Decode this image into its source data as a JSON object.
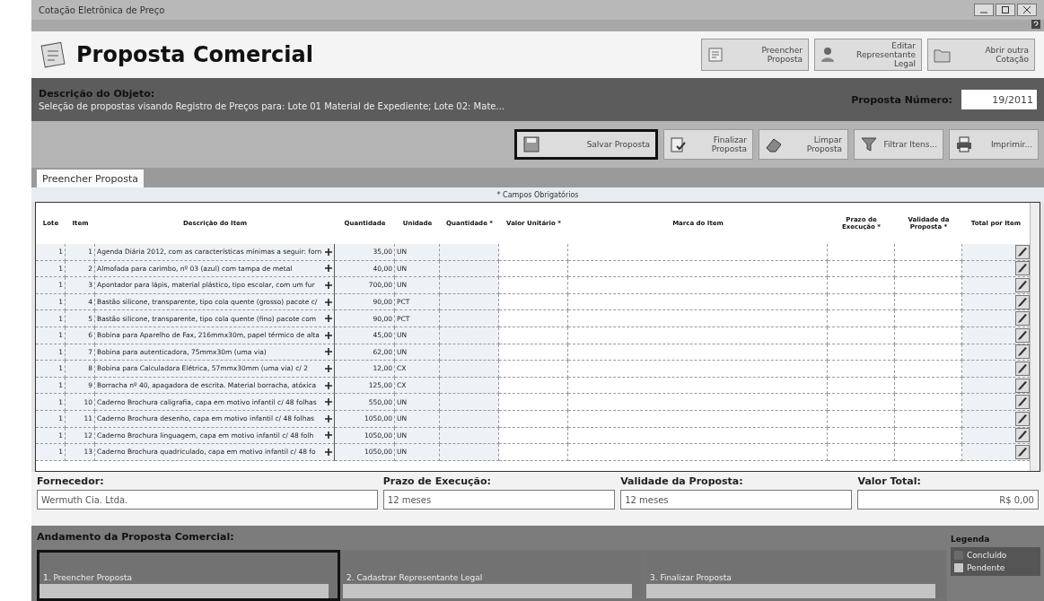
{
  "window": {
    "title": "Cotação Eletrônica de Preço"
  },
  "header": {
    "title": "Proposta Comercial",
    "buttons": [
      {
        "label": "Preencher Proposta",
        "kind": "form"
      },
      {
        "label": "Editar Representante Legal",
        "kind": "person"
      },
      {
        "label": "Abrir outra Cotação",
        "kind": "folder"
      }
    ]
  },
  "description": {
    "label": "Descrição do Objeto:",
    "text": "Seleção de propostas visando Registro de Preços para: Lote 01 Material de Expediente; Lote 02: Mate...",
    "number_label": "Proposta Número:",
    "number": "19/2011"
  },
  "toolbar": [
    {
      "label": "Salvar Proposta",
      "kind": "save",
      "highlighted": true
    },
    {
      "label": "Finalizar Proposta",
      "kind": "finish",
      "highlighted": false
    },
    {
      "label": "Limpar Proposta",
      "kind": "eraser",
      "highlighted": false
    },
    {
      "label": "Filtrar Itens...",
      "kind": "filter",
      "highlighted": false
    },
    {
      "label": "Imprimir...",
      "kind": "print",
      "highlighted": false
    }
  ],
  "tabs": [
    {
      "label": "Preencher Proposta",
      "selected": true
    }
  ],
  "required_note": "* Campos Obrigatórios",
  "table": {
    "columns": [
      "Lote",
      "Item",
      "Descrição do Item",
      "Quantidade",
      "Unidade",
      "Quantidade *",
      "Valor Unitário *",
      "Marca do Item",
      "Prazo de Execução *",
      "Validade da Proposta *",
      "Total por Item"
    ],
    "rows": [
      {
        "lote": "1",
        "item": "1",
        "description": "Agenda Diária 2012, com as características mínimas a seguir: forn",
        "quantity": "35,00",
        "unit": "UN"
      },
      {
        "lote": "1",
        "item": "2",
        "description": "Almofada para carimbo, nº 03 (azul) com tampa de metal",
        "quantity": "40,00",
        "unit": "UN"
      },
      {
        "lote": "1",
        "item": "3",
        "description": "Apontador para lápis, material plástico, tipo escolar, com um fur",
        "quantity": "700,00",
        "unit": "UN"
      },
      {
        "lote": "1",
        "item": "4",
        "description": "Bastão silicone, transparente, tipo cola quente (grosso) pacote c/",
        "quantity": "90,00",
        "unit": "PCT"
      },
      {
        "lote": "1",
        "item": "5",
        "description": "Bastão silicone, transparente, tipo cola quente (fino) pacote com",
        "quantity": "90,00",
        "unit": "PCT"
      },
      {
        "lote": "1",
        "item": "6",
        "description": "Bobina para Aparelho de Fax, 216mmx30m, papel térmico de alta",
        "quantity": "45,00",
        "unit": "UN"
      },
      {
        "lote": "1",
        "item": "7",
        "description": "Bobina para autenticadora, 75mmx30m (uma via)",
        "quantity": "62,00",
        "unit": "UN"
      },
      {
        "lote": "1",
        "item": "8",
        "description": "Bobina para Calculadora Elétrica, 57mmx30mm (uma via) c/ 2",
        "quantity": "12,00",
        "unit": "CX"
      },
      {
        "lote": "1",
        "item": "9",
        "description": "Borracha nº 40, apagadora de escrita. Material borracha, atóxica",
        "quantity": "125,00",
        "unit": "CX"
      },
      {
        "lote": "1",
        "item": "10",
        "description": "Caderno Brochura caligrafia, capa em motivo infantil c/ 48 folhas",
        "quantity": "550,00",
        "unit": "UN"
      },
      {
        "lote": "1",
        "item": "11",
        "description": "Caderno Brochura desenho, capa em motivo infantil c/ 48 folhas",
        "quantity": "1050,00",
        "unit": "UN"
      },
      {
        "lote": "1",
        "item": "12",
        "description": "Caderno Brochura linguagem, capa em motivo infantil c/ 48 folh",
        "quantity": "1050,00",
        "unit": "UN"
      },
      {
        "lote": "1",
        "item": "13",
        "description": "Caderno Brochura quadriculado, capa em motivo infantil c/ 48 fo",
        "quantity": "1050,00",
        "unit": "UN"
      }
    ]
  },
  "footer": [
    {
      "label": "Fornecedor:",
      "value": "Wermuth Cia. Ltda."
    },
    {
      "label": "Prazo de Execução:",
      "value": "12 meses"
    },
    {
      "label": "Validade da Proposta:",
      "value": "12 meses"
    },
    {
      "label": "Valor Total:",
      "value": "R$ 0,00"
    }
  ],
  "progress": {
    "title": "Andamento da Proposta Comercial:",
    "steps": [
      {
        "label": "1. Preencher Proposta",
        "done": false,
        "highlighted": true
      },
      {
        "label": "2. Cadastrar Representante Legal",
        "done": false,
        "highlighted": false
      },
      {
        "label": "3. Finalizar Proposta",
        "done": false,
        "highlighted": false
      }
    ],
    "legend": {
      "title": "Legenda",
      "items": [
        {
          "label": "Concluído",
          "color": "#6a6a6a"
        },
        {
          "label": "Pendente",
          "color": "#c8c8c8"
        }
      ]
    }
  }
}
